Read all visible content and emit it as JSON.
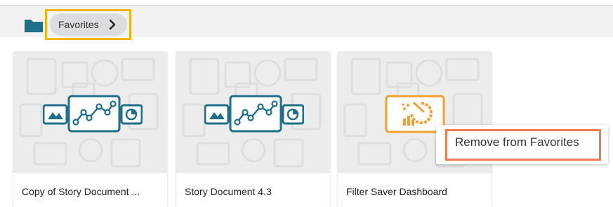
{
  "breadcrumb": {
    "root_icon": "folder-icon",
    "current_label": "Favorites",
    "chevron_icon": "chevron-right-icon",
    "highlight_color": "#f5b400"
  },
  "cards": [
    {
      "title": "Copy of Story Document ...",
      "thumbnail_icon": "story-document-icon",
      "accent": "#1f6f8b"
    },
    {
      "title": "Story Document 4.3",
      "thumbnail_icon": "story-document-icon",
      "accent": "#1f6f8b"
    },
    {
      "title": "Filter Saver Dashboard",
      "thumbnail_icon": "dashboard-icon",
      "accent": "#f0a030"
    }
  ],
  "context_menu": {
    "items": [
      {
        "label": "Remove from Favorites"
      }
    ],
    "highlight_color": "#ee7b52"
  }
}
